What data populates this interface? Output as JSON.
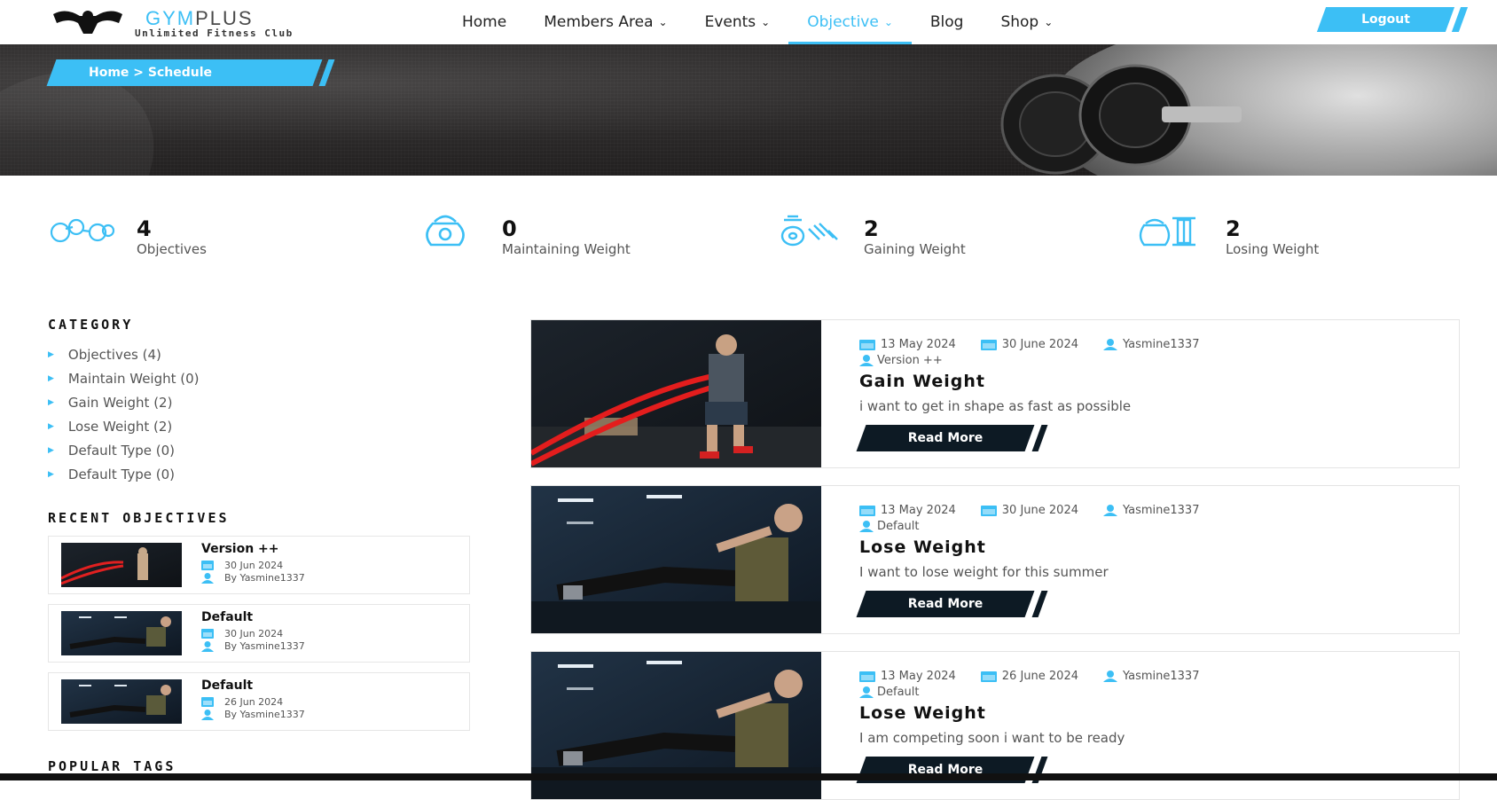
{
  "colors": {
    "accent": "#3cbff5",
    "dark": "#0d1a24"
  },
  "header": {
    "logo_main_prefix": "GYM",
    "logo_main_suffix": "PLUS",
    "logo_sub": "Unlimited Fitness Club",
    "nav": [
      {
        "label": "Home",
        "dropdown": false,
        "active": false
      },
      {
        "label": "Members Area",
        "dropdown": true,
        "active": false
      },
      {
        "label": "Events",
        "dropdown": true,
        "active": false
      },
      {
        "label": "Objective",
        "dropdown": true,
        "active": true
      },
      {
        "label": "Blog",
        "dropdown": false,
        "active": false
      },
      {
        "label": "Shop",
        "dropdown": true,
        "active": false
      }
    ],
    "logout_label": "Logout"
  },
  "hero": {
    "breadcrumb": "Home  >  Schedule"
  },
  "stats": [
    {
      "icon": "dumbbells-icon",
      "value": "4",
      "label": "Objectives"
    },
    {
      "icon": "kettlebell-icon",
      "value": "0",
      "label": "Maintaining Weight"
    },
    {
      "icon": "weight-plates-icon",
      "value": "2",
      "label": "Gaining Weight"
    },
    {
      "icon": "kettlebell-dumbbell-icon",
      "value": "2",
      "label": "Losing Weight"
    }
  ],
  "sidebar": {
    "category_title": "CATEGORY",
    "categories": [
      "Objectives (4)",
      "Maintain Weight (0)",
      "Gain Weight (2)",
      "Lose Weight (2)",
      "Default Type (0)",
      "Default Type (0)"
    ],
    "recent_title": "RECENT OBJECTIVES",
    "recent": [
      {
        "title": "Version ++",
        "date": "30 Jun 2024",
        "author": "By Yasmine1337"
      },
      {
        "title": "Default",
        "date": "30 Jun 2024",
        "author": "By Yasmine1337"
      },
      {
        "title": "Default",
        "date": "26 Jun 2024",
        "author": "By Yasmine1337"
      }
    ],
    "tags_title": "POPULAR TAGS"
  },
  "cards": [
    {
      "start": "13 May 2024",
      "end": "30 June 2024",
      "author": "Yasmine1337",
      "type": "Version ++",
      "title": "Gain Weight",
      "description": "i want to get in shape as fast as possible",
      "button": "Read More"
    },
    {
      "start": "13 May 2024",
      "end": "30 June 2024",
      "author": "Yasmine1337",
      "type": "Default",
      "title": "Lose Weight",
      "description": "I want to lose weight for this summer",
      "button": "Read More"
    },
    {
      "start": "13 May 2024",
      "end": "26 June 2024",
      "author": "Yasmine1337",
      "type": "Default",
      "title": "Lose Weight",
      "description": "I am competing soon i want to be ready",
      "button": "Read More"
    }
  ]
}
